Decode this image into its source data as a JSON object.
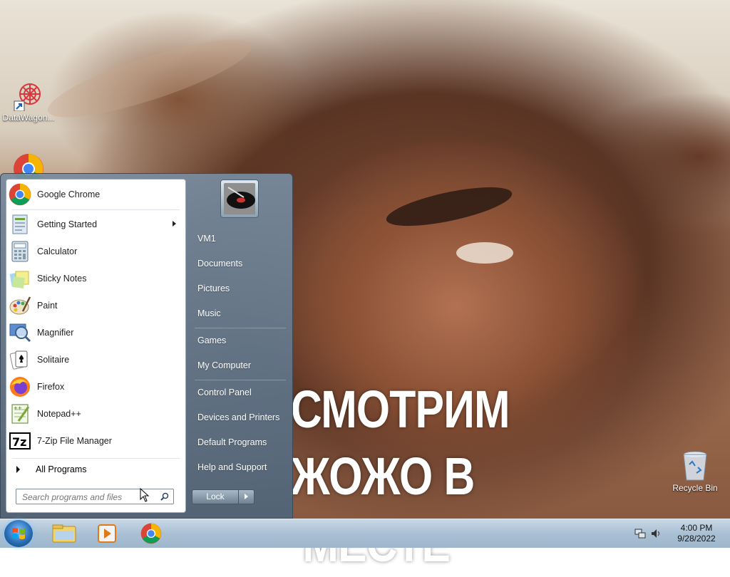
{
  "wallpaper": {
    "meme_line1": "СМОТРИМ ЖОЖО В",
    "meme_line2": "МЕСТЕ"
  },
  "desktop_icons": [
    {
      "label": "DataWagon...",
      "icon": "datawagon-icon"
    },
    {
      "label": "",
      "icon": "chrome-icon"
    },
    {
      "label": "Recycle Bin",
      "icon": "recycle-bin-icon"
    }
  ],
  "start_menu": {
    "programs": [
      {
        "label": "Google Chrome",
        "icon": "chrome-icon",
        "has_submenu": false
      },
      {
        "label": "Getting Started",
        "icon": "getting-started-icon",
        "has_submenu": true
      },
      {
        "label": "Calculator",
        "icon": "calculator-icon",
        "has_submenu": false
      },
      {
        "label": "Sticky Notes",
        "icon": "sticky-notes-icon",
        "has_submenu": false
      },
      {
        "label": "Paint",
        "icon": "paint-icon",
        "has_submenu": false
      },
      {
        "label": "Magnifier",
        "icon": "magnifier-icon",
        "has_submenu": false
      },
      {
        "label": "Solitaire",
        "icon": "solitaire-icon",
        "has_submenu": false
      },
      {
        "label": "Firefox",
        "icon": "firefox-icon",
        "has_submenu": false
      },
      {
        "label": "Notepad++",
        "icon": "notepadpp-icon",
        "has_submenu": false
      },
      {
        "label": "7-Zip File Manager",
        "icon": "7zip-icon",
        "has_submenu": false
      }
    ],
    "all_programs_label": "All Programs",
    "search_placeholder": "Search programs and files",
    "right_links": [
      "VM1",
      "Documents",
      "Pictures",
      "Music",
      "Games",
      "My Computer",
      "Control Panel",
      "Devices and Printers",
      "Default Programs",
      "Help and Support"
    ],
    "lock_label": "Lock"
  },
  "taskbar": {
    "pinned": [
      {
        "name": "windows-explorer-icon"
      },
      {
        "name": "media-player-icon"
      },
      {
        "name": "chrome-icon"
      }
    ],
    "clock_time": "4:00 PM",
    "clock_date": "9/28/2022"
  },
  "colors": {
    "taskbar": "#a9c0d4",
    "start_right_pane": "#6e8599",
    "meme_text": "#ffffff"
  }
}
